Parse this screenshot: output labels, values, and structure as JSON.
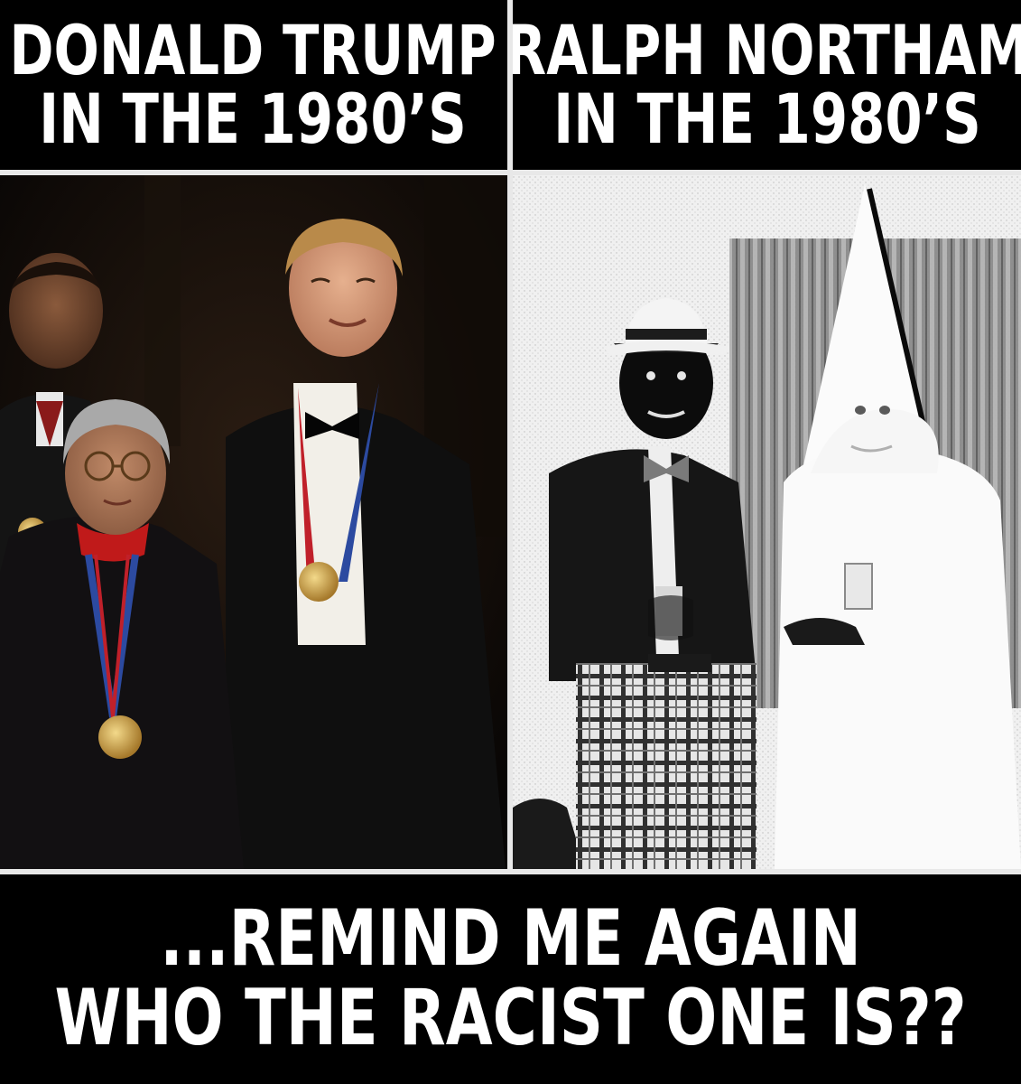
{
  "header": {
    "left": {
      "line1": "DONALD TRUMP",
      "line2": "IN THE 1980’S"
    },
    "right": {
      "line1": "RALPH NORTHAM",
      "line2": "IN THE 1980’S"
    }
  },
  "footer": {
    "line1": "...REMIND ME AGAIN",
    "line2": "WHO THE RACIST ONE IS??"
  },
  "colors": {
    "background": "#000000",
    "text": "#ffffff",
    "divider": "#e8e8e8"
  }
}
